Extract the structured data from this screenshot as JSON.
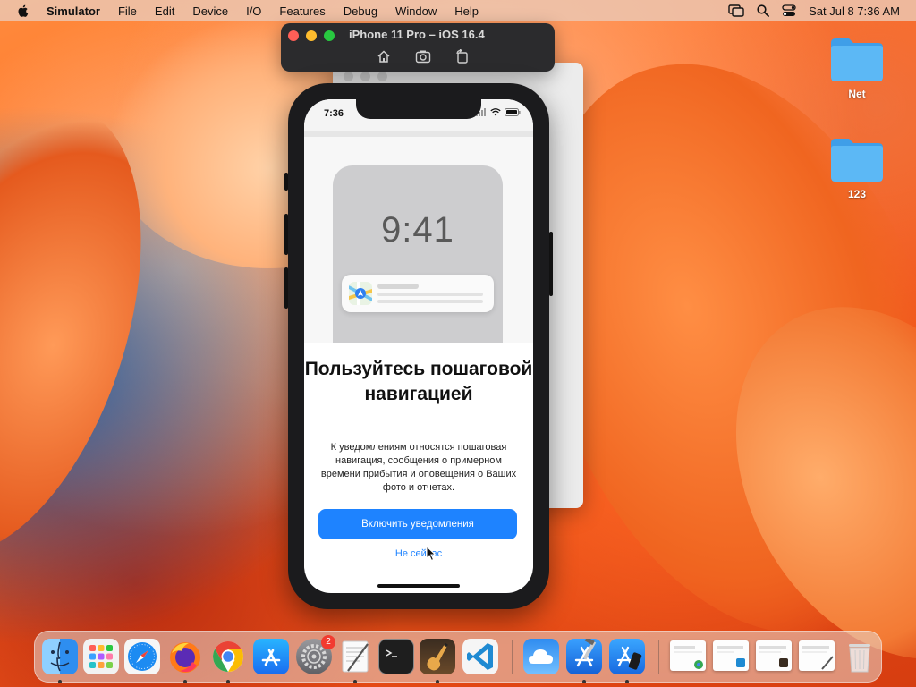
{
  "menubar": {
    "app_name": "Simulator",
    "items": [
      "File",
      "Edit",
      "Device",
      "I/O",
      "Features",
      "Debug",
      "Window",
      "Help"
    ],
    "datetime": "Sat Jul 8  7:36 AM"
  },
  "simulator": {
    "window_title": "iPhone 11 Pro – iOS 16.4"
  },
  "device": {
    "status_time": "7:36",
    "hero_clock": "9:41",
    "heading": "Пользуйтесь пошаговой навигацией",
    "description": "К уведомлениям относятся пошаговая навигация, сообщения о примерном времени прибытия и оповещения о Ваших фото и отчетах.",
    "primary_button": "Включить уведомления",
    "secondary_button": "Не сейчас"
  },
  "desktop": {
    "icons": [
      {
        "label": "Net"
      },
      {
        "label": "123"
      }
    ]
  },
  "dock": {
    "apps": [
      {
        "name": "finder-icon"
      },
      {
        "name": "launchpad-icon"
      },
      {
        "name": "safari-icon"
      },
      {
        "name": "firefox-icon"
      },
      {
        "name": "chrome-icon"
      },
      {
        "name": "app-store-icon"
      },
      {
        "name": "system-settings-icon",
        "badge": "2"
      },
      {
        "name": "textedit-icon"
      },
      {
        "name": "terminal-icon"
      },
      {
        "name": "instruments-icon"
      },
      {
        "name": "vscode-icon"
      },
      {
        "name": "weather-icon"
      },
      {
        "name": "xcode-icon"
      },
      {
        "name": "simulator-icon"
      }
    ]
  },
  "colors": {
    "accent_blue": "#1e83ff",
    "badge_red": "#f23b30"
  }
}
